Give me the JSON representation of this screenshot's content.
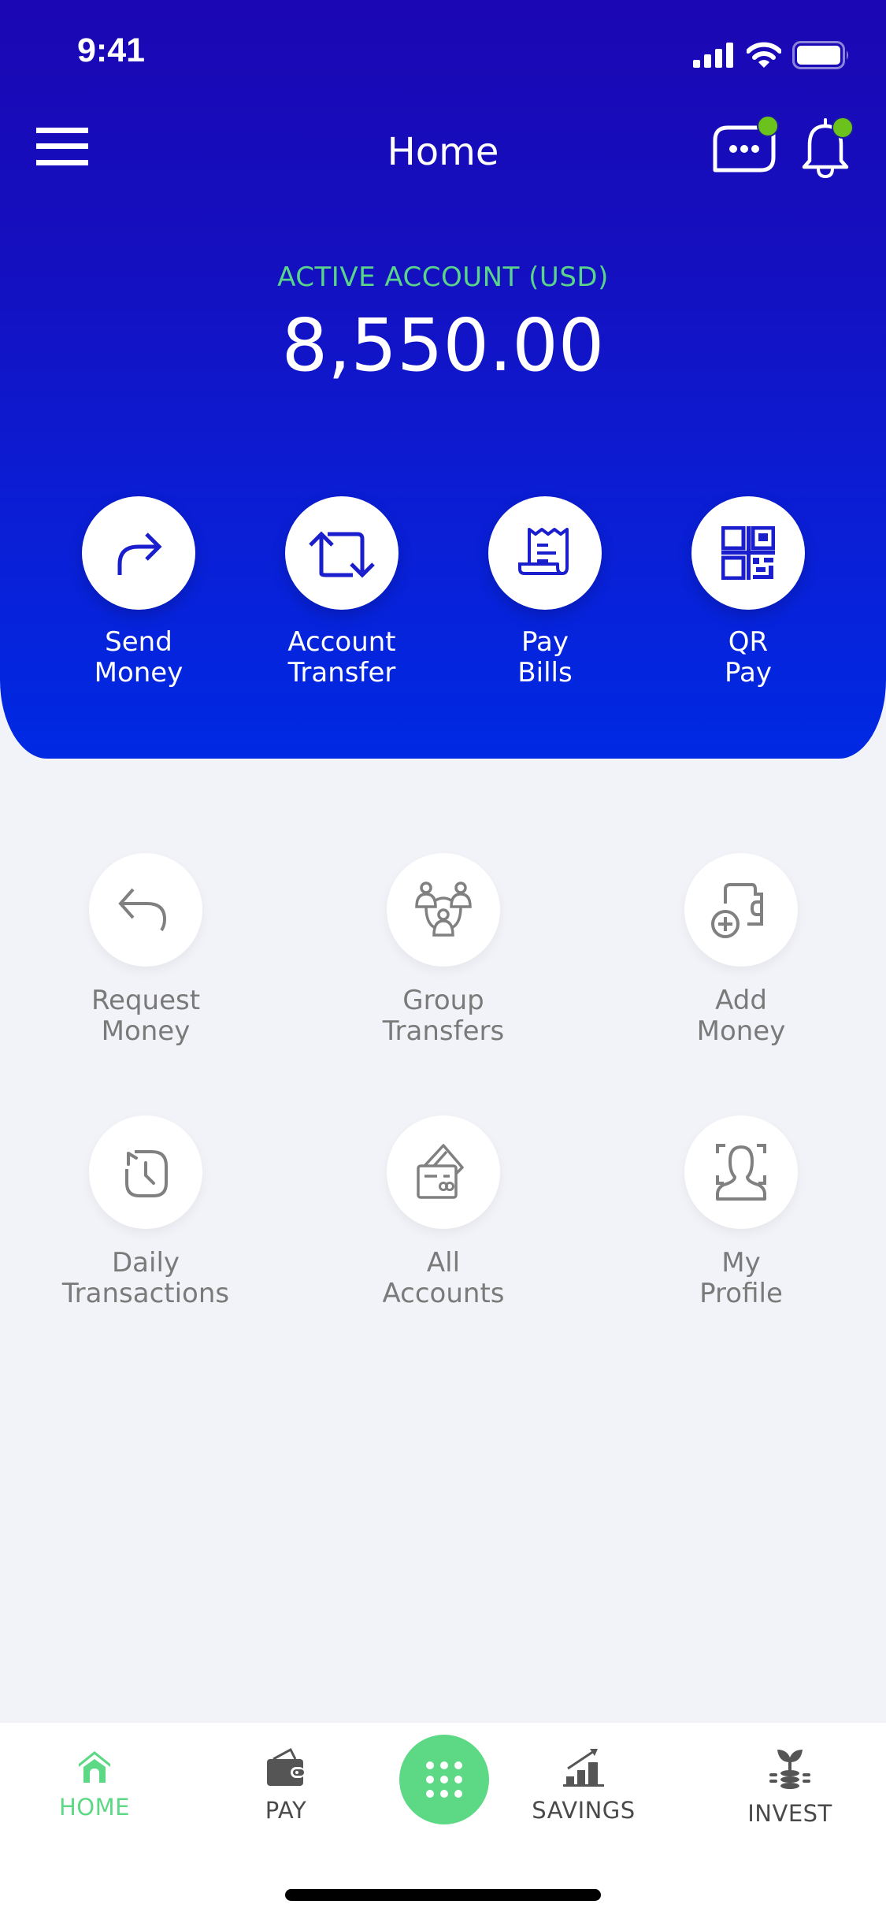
{
  "status_bar": {
    "time": "9:41"
  },
  "header": {
    "title": "Home",
    "menu_icon": "hamburger-menu-icon",
    "chat_icon": "chat-bubble-icon",
    "bell_icon": "notification-bell-icon",
    "badge_color": "#6cc21c"
  },
  "account": {
    "label": "ACTIVE  ACCOUNT (USD)",
    "balance": "8,550.00"
  },
  "quick_actions": [
    {
      "line1": "Send",
      "line2": "Money",
      "icon": "send-arrow-icon"
    },
    {
      "line1": "Account",
      "line2": "Transfer",
      "icon": "transfer-loop-icon"
    },
    {
      "line1": "Pay",
      "line2": "Bills",
      "icon": "receipt-icon"
    },
    {
      "line1": "QR",
      "line2": "Pay",
      "icon": "qr-code-icon"
    }
  ],
  "services": [
    {
      "line1": "Request",
      "line2": "Money",
      "icon": "reply-arrow-icon"
    },
    {
      "line1": "Group",
      "line2": "Transfers",
      "icon": "group-users-icon"
    },
    {
      "line1": "Add",
      "line2": "Money",
      "icon": "wallet-add-icon"
    },
    {
      "line1": "Daily",
      "line2": "Transactions",
      "icon": "history-clock-icon"
    },
    {
      "line1": "All",
      "line2": "Accounts",
      "icon": "cards-icon"
    },
    {
      "line1": "My",
      "line2": "Profile",
      "icon": "profile-scan-icon"
    }
  ],
  "tabbar": {
    "tabs": [
      {
        "label": "HOME",
        "icon": "home-icon",
        "active": true
      },
      {
        "label": "PAY",
        "icon": "wallet-icon",
        "active": false
      },
      {
        "label": "SAVINGS",
        "icon": "growth-chart-icon",
        "active": false
      },
      {
        "label": "INVEST",
        "icon": "plant-coins-icon",
        "active": false
      }
    ],
    "center_button_icon": "grid-dots-icon"
  },
  "colors": {
    "primary_blue": "#1410c0",
    "accent_green": "#5dd985",
    "label_gray": "#7a7a7a",
    "background": "#f2f3f8"
  }
}
